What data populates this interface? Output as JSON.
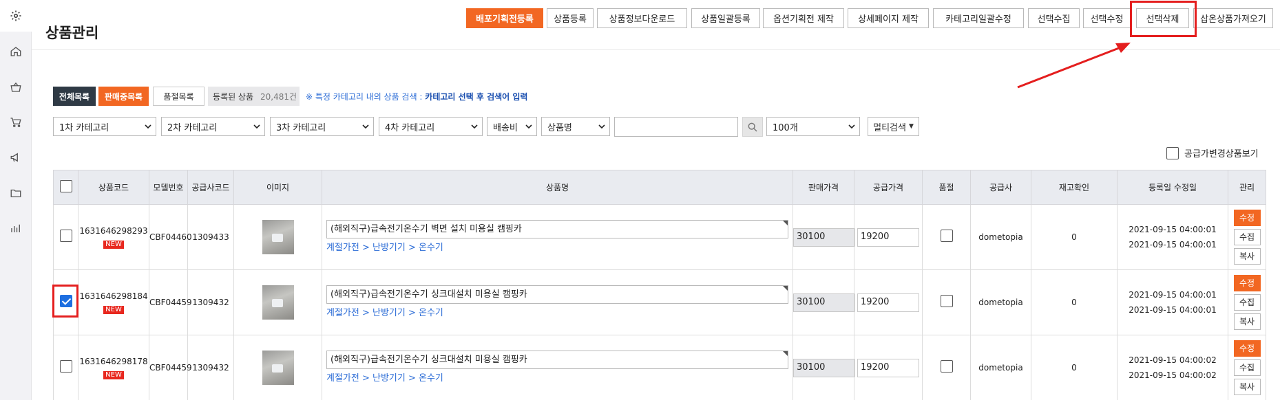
{
  "page_title": "상품관리",
  "sidebar": [
    {
      "icon": "gear-icon"
    },
    {
      "icon": "home-icon"
    },
    {
      "icon": "basket-icon"
    },
    {
      "icon": "cart-icon"
    },
    {
      "icon": "megaphone-icon"
    },
    {
      "icon": "folder-icon"
    },
    {
      "icon": "bar-chart-icon"
    }
  ],
  "toolbar": {
    "buttons": [
      "배포기획전등록",
      "상품등록",
      "상품정보다운로드",
      "상품일괄등록",
      "옵션기획전 제작",
      "상세페이지 제작",
      "카테고리일괄수정",
      "선택수집",
      "선택수정",
      "선택삭제",
      "삽온상품가져오기"
    ]
  },
  "list_tabs": {
    "all": "전체목록",
    "on_sale": "판매중목록",
    "sold_out": "품절목록",
    "registered_label": "등록된 상품",
    "registered_count": "20,481건"
  },
  "hint": {
    "prefix": "※ 특정 카테고리 내의 상품 검색 : ",
    "emph": "카테고리 선택 후 검색어 입력"
  },
  "filters": {
    "cat1": "1차 카테고리",
    "cat2": "2차 카테고리",
    "cat3": "3차 카테고리",
    "cat4": "4차 카테고리",
    "shipping": "배송비",
    "field": "상품명",
    "search_value": "",
    "page_size": "100개",
    "multi_search": "멀티검색"
  },
  "supply_change_label": "공급가변경상품보기",
  "table": {
    "headers": {
      "code": "상품코드",
      "model": "모델번호",
      "supplier_code": "공급사코드",
      "image": "이미지",
      "name": "상품명",
      "sale_price": "판매가격",
      "supply_price": "공급가격",
      "sold_out": "품절",
      "supplier": "공급사",
      "stock": "재고확인",
      "dates": "등록일 수정일",
      "manage": "관리"
    },
    "rows": [
      {
        "code": "1631646298293",
        "badge": "NEW",
        "model": "CBF04460",
        "supplier_code": "1309433",
        "name": "(해외직구)급속전기온수기 벽면 설치 미용실 캠핑카",
        "path": "계절가전 > 난방기기 > 온수기",
        "sale_price": "30100",
        "supply_price": "19200",
        "supplier": "dometopia",
        "stock": "0",
        "registered": "2021-09-15 04:00:01",
        "modified": "2021-09-15 04:00:01",
        "checked": false
      },
      {
        "code": "1631646298184",
        "badge": "NEW",
        "model": "CBF04459",
        "supplier_code": "1309432",
        "name": "(해외직구)급속전기온수기 싱크대설치 미용실 캠핑카",
        "path": "계절가전 > 난방기기 > 온수기",
        "sale_price": "30100",
        "supply_price": "19200",
        "supplier": "dometopia",
        "stock": "0",
        "registered": "2021-09-15 04:00:01",
        "modified": "2021-09-15 04:00:01",
        "checked": true
      },
      {
        "code": "1631646298178",
        "badge": "NEW",
        "model": "CBF04459",
        "supplier_code": "1309432",
        "name": "(해외직구)급속전기온수기 싱크대설치 미용실 캠핑카",
        "path": "계절가전 > 난방기기 > 온수기",
        "sale_price": "30100",
        "supply_price": "19200",
        "supplier": "dometopia",
        "stock": "0",
        "registered": "2021-09-15 04:00:02",
        "modified": "2021-09-15 04:00:02",
        "checked": false
      }
    ],
    "actions": {
      "edit": "수정",
      "collect": "수집",
      "copy": "복사"
    }
  },
  "colors": {
    "accent_orange": "#f26722",
    "annotation_red": "#e41e1e",
    "link_blue": "#2a6bd6",
    "dark_tab": "#2f3a45"
  }
}
